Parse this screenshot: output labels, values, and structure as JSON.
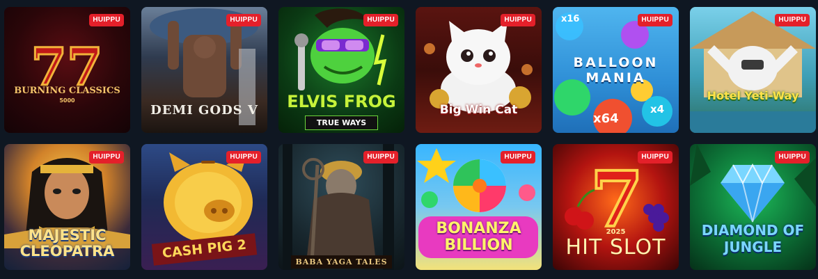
{
  "badge_label": "HUIPPU",
  "games": [
    {
      "title": "BURNING CLASSICS",
      "subtitle": "5000"
    },
    {
      "title": "DEMI GODS V",
      "subtitle": ""
    },
    {
      "title": "ELVIS FROG",
      "subtitle": "TRUE WAYS"
    },
    {
      "title": "Big Win Cat",
      "subtitle": ""
    },
    {
      "title": "BALLOON MANIA",
      "subtitle": ""
    },
    {
      "title": "Hotel Yeti-Way",
      "subtitle": ""
    },
    {
      "title": "MAJESTIC CLEOPATRA",
      "subtitle": ""
    },
    {
      "title": "CASH PIG 2",
      "subtitle": ""
    },
    {
      "title": "BABA YAGA TALES",
      "subtitle": ""
    },
    {
      "title": "BONANZA BILLION",
      "subtitle": ""
    },
    {
      "title": "HIT SLOT",
      "subtitle": "2025"
    },
    {
      "title": "DIAMOND OF JUNGLE",
      "subtitle": ""
    }
  ],
  "balloon_values": [
    "x16",
    "x64",
    "x4"
  ]
}
